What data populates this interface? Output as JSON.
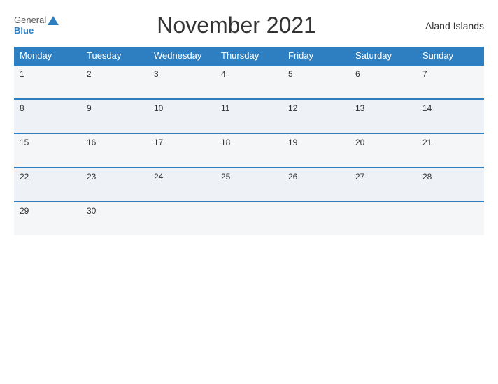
{
  "header": {
    "logo_general": "General",
    "logo_blue": "Blue",
    "title": "November 2021",
    "region": "Aland Islands"
  },
  "weekdays": [
    "Monday",
    "Tuesday",
    "Wednesday",
    "Thursday",
    "Friday",
    "Saturday",
    "Sunday"
  ],
  "weeks": [
    [
      "1",
      "2",
      "3",
      "4",
      "5",
      "6",
      "7"
    ],
    [
      "8",
      "9",
      "10",
      "11",
      "12",
      "13",
      "14"
    ],
    [
      "15",
      "16",
      "17",
      "18",
      "19",
      "20",
      "21"
    ],
    [
      "22",
      "23",
      "24",
      "25",
      "26",
      "27",
      "28"
    ],
    [
      "29",
      "30",
      "",
      "",
      "",
      "",
      ""
    ]
  ]
}
